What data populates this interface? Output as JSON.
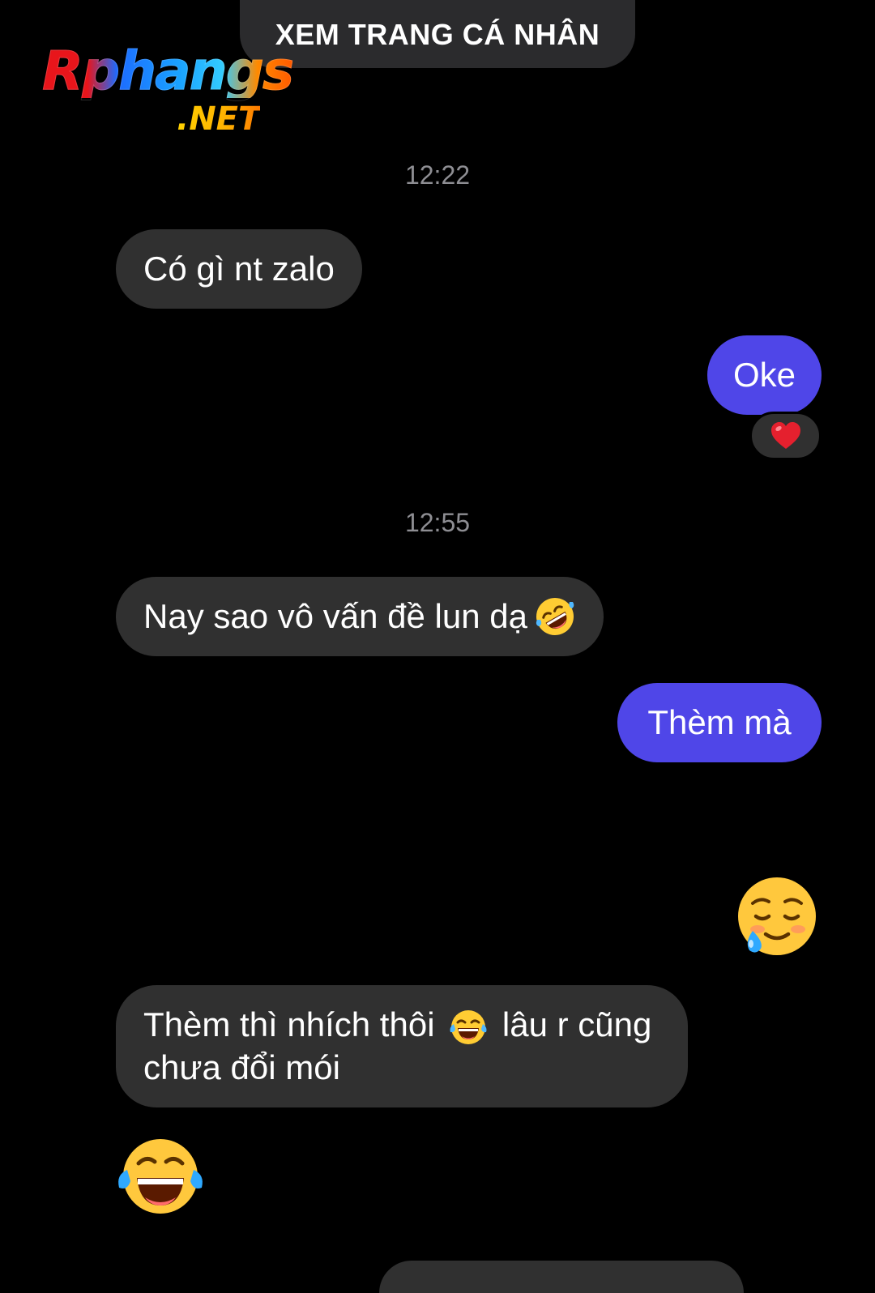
{
  "header": {
    "profile_button_label": "XEM TRANG CÁ NHÂN"
  },
  "watermark": {
    "brand": "Rphangs",
    "domain": ".NET"
  },
  "messages": {
    "ts1": "12:22",
    "m1": "Có gì nt zalo",
    "m2": "Oke",
    "m2_reaction": "heart-icon",
    "ts2": "12:55",
    "m3": "Nay sao vô vấn đề lun dạ",
    "m3_emoji": "rolling-on-floor-laughing-icon",
    "m4": "Thèm mà",
    "m5_sticker": "smiling-face-with-tear-icon",
    "m6_line1_a": "Thèm thì nhích thôi",
    "m6_emoji": "tears-of-joy-icon",
    "m6_line1_b": "lâu r cũng",
    "m6_line2": "chưa đổi mói",
    "m7_sticker": "tears-of-joy-icon"
  },
  "colors": {
    "background": "#000000",
    "incoming_bubble": "#303030",
    "outgoing_bubble": "#4f46e8",
    "timestamp": "#8e8e93"
  }
}
